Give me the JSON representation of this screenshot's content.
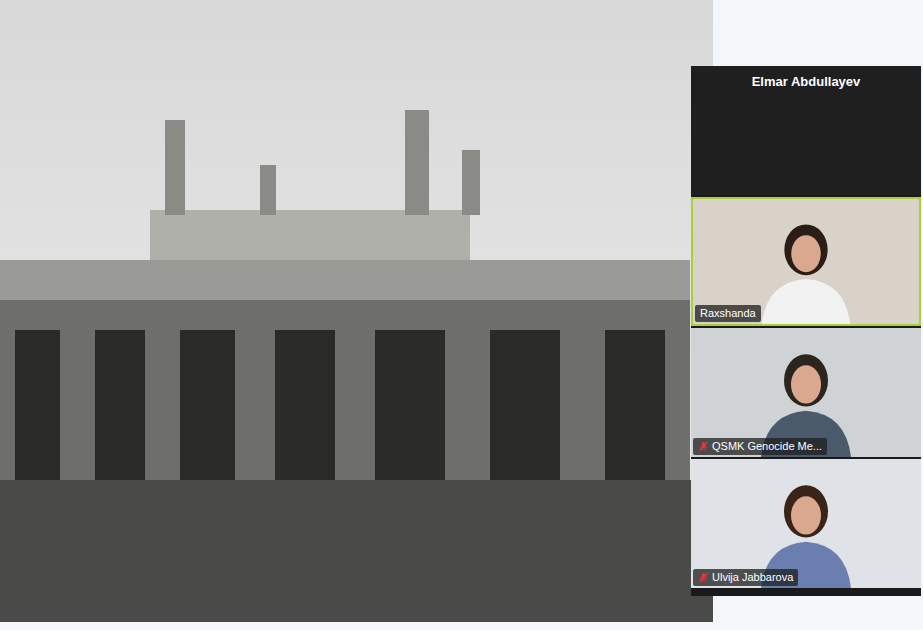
{
  "shared_screen": {
    "content": "photo"
  },
  "participants": [
    {
      "name": "Elmar Abdullayev",
      "kind": "name-only",
      "active_speaker": false,
      "muted": false
    },
    {
      "name": "Raxshanda",
      "kind": "video",
      "active_speaker": true,
      "muted": false
    },
    {
      "name": "QSMK Genocide Me...",
      "kind": "video",
      "active_speaker": false,
      "muted": true
    },
    {
      "name": "Ulvija Jabbarova",
      "kind": "video",
      "active_speaker": false,
      "muted": true
    }
  ]
}
